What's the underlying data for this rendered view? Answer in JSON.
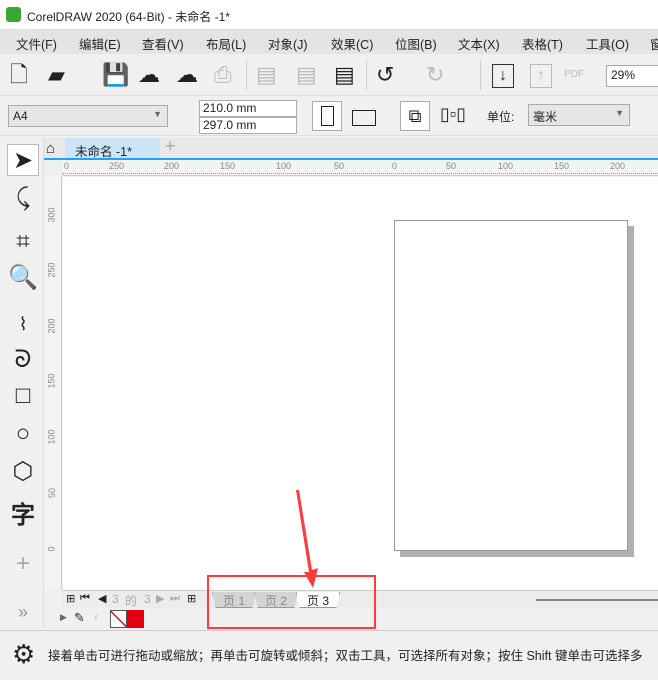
{
  "window": {
    "title": "CorelDRAW 2020 (64-Bit) - 未命名 -1*"
  },
  "menu": [
    "文件(F)",
    "编辑(E)",
    "查看(V)",
    "布局(L)",
    "对象(J)",
    "效果(C)",
    "位图(B)",
    "文本(X)",
    "表格(T)",
    "工具(O)",
    "窗"
  ],
  "toolbar": {
    "zoom": "29%",
    "pdf_label": "PDF"
  },
  "property_bar": {
    "page_size": "A4",
    "width": "210.0 mm",
    "height": "297.0 mm",
    "units_label": "单位:",
    "units": "毫米"
  },
  "doc_tab": {
    "title": "未命名 -1*"
  },
  "hruler": [
    "0",
    "250",
    "200",
    "150",
    "100",
    "50",
    "0",
    "50",
    "100",
    "150",
    "200"
  ],
  "vruler": [
    "300",
    "250",
    "200",
    "150",
    "100",
    "50",
    "0"
  ],
  "page_nav": {
    "current": "3",
    "of": "的",
    "total": "3",
    "tabs": [
      "页 1",
      "页 2",
      "页 3"
    ],
    "active": 2
  },
  "toolbox": {
    "text_tool": "字"
  },
  "colors": {
    "accent": "#1aa3ff",
    "highlight": "#ff3b3b",
    "fill_swatch": "#e30012"
  },
  "status": {
    "message": "接着单击可进行拖动或缩放；再单击可旋转或倾斜；双击工具，可选择所有对象；按住 Shift 键单击可选择多"
  }
}
